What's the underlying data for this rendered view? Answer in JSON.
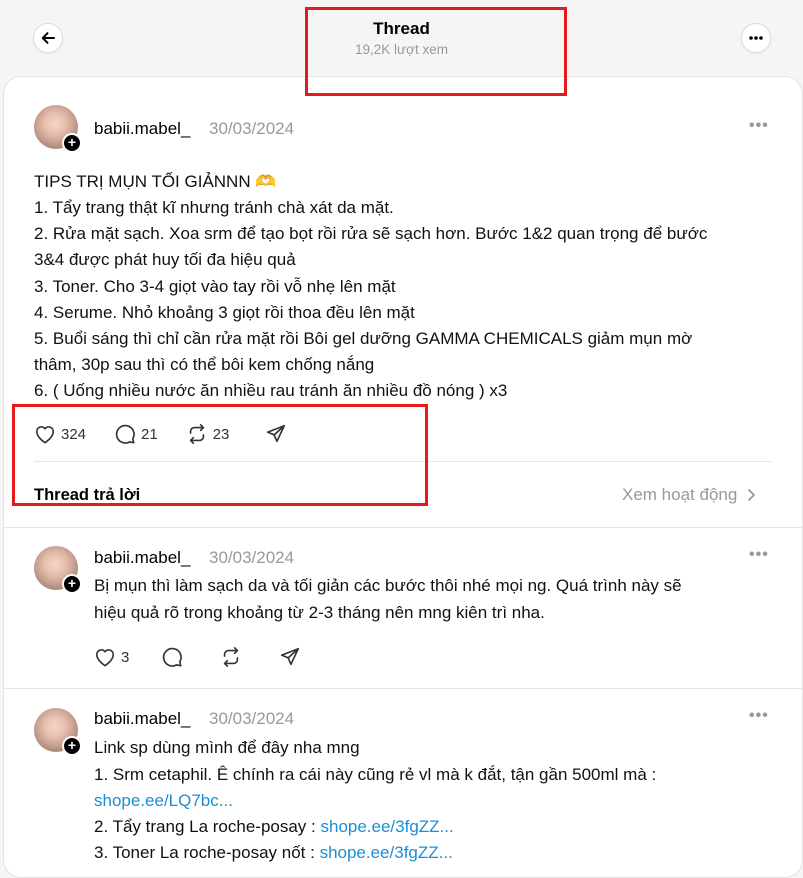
{
  "header": {
    "title": "Thread",
    "views": "19,2K lượt xem"
  },
  "main_post": {
    "username": "babii.mabel_",
    "date": "30/03/2024",
    "lines": [
      "TIPS TRỊ MỤN TỐI GIẢNNN 🫶",
      "1. Tẩy trang thật kĩ nhưng tránh chà xát da mặt.",
      "2. Rửa mặt sạch. Xoa srm để tạo bọt rồi rửa sẽ sạch hơn. Bước 1&2 quan trọng để bước",
      "3&4 được phát huy tối đa hiệu quả",
      "3. Toner. Cho 3-4 giọt vào tay rồi vỗ nhẹ lên mặt",
      "4. Serume. Nhỏ khoảng 3 giọt rồi thoa đều lên mặt",
      "5. Buổi sáng thì chỉ cần rửa mặt rồi Bôi gel dưỡng GAMMA CHEMICALS giảm mụn mờ",
      "thâm, 30p sau thì có thể bôi kem chống nắng",
      "6. ( Uống nhiều nước ăn nhiều rau tránh ăn nhiều đồ nóng ) x3"
    ],
    "likes": "324",
    "comments": "21",
    "reposts": "23"
  },
  "replies_section": {
    "label": "Thread trả lời",
    "activity_link": "Xem hoạt động"
  },
  "reply1": {
    "username": "babii.mabel_",
    "date": "30/03/2024",
    "lines": [
      "Bị mụn thì làm sạch da và tối giản các bước thôi nhé mọi ng. Quá trình này sẽ",
      "hiệu quả rõ trong khoảng từ 2-3 tháng nên mng kiên trì nha."
    ],
    "likes": "3"
  },
  "reply2": {
    "username": "babii.mabel_",
    "date": "30/03/2024",
    "line1": "Link sp dùng mình để đây nha mng",
    "line2": "1. Srm cetaphil. Ê chính ra cái này cũng rẻ vl mà k đắt, tận gần 500ml mà :",
    "link1": "shope.ee/LQ7bc...",
    "line4_text": "2. Tẩy trang La roche-posay : ",
    "link2": "shope.ee/3fgZZ...",
    "line5_text": "3. Toner La roche-posay nốt : ",
    "link3": "shope.ee/3fgZZ..."
  },
  "icons": [
    "back-arrow-icon",
    "more-icon",
    "plus-icon",
    "heart-icon",
    "comment-icon",
    "repost-icon",
    "share-icon",
    "chevron-right-icon"
  ],
  "colors": {
    "link": "#1a8fd6",
    "highlight": "#e31b1b",
    "muted": "#999999"
  }
}
